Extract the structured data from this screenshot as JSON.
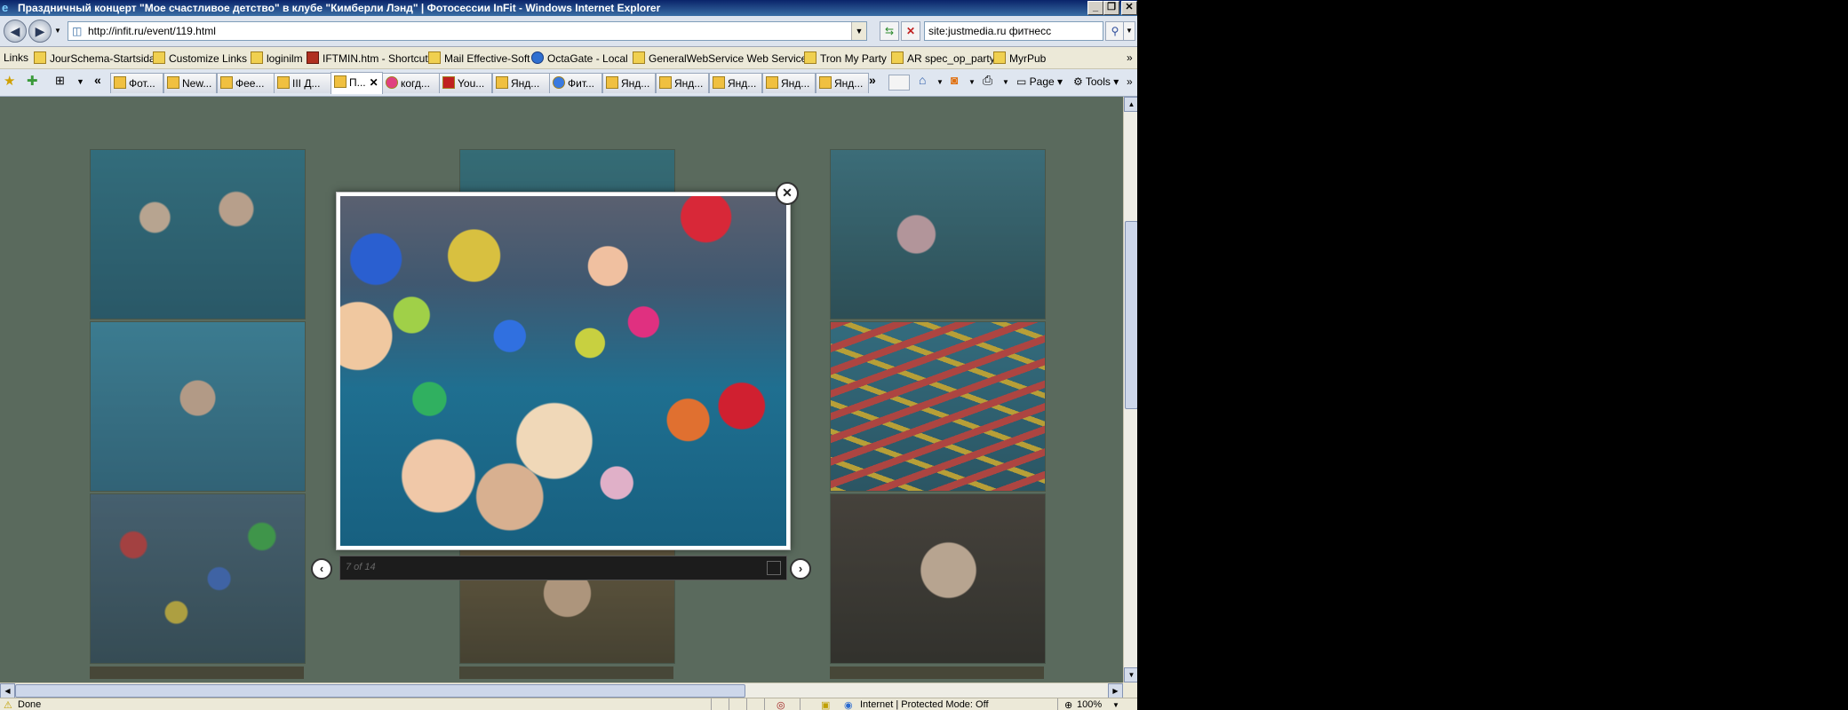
{
  "window": {
    "title": "Праздничный концерт \"Мое счастливое детство\" в клубе \"Кимберли Лэнд\" | Фотосессии InFit - Windows Internet Explorer",
    "controls": [
      "_",
      "❐",
      "✕"
    ]
  },
  "address": {
    "url": "http://infit.ru/event/119.html",
    "search_value": "site:justmedia.ru фитнесс"
  },
  "links_bar": {
    "label": "Links",
    "items": [
      "JourSchema-Startsida",
      "Customize Links",
      "loginilm",
      "IFTMIN.htm - Shortcut",
      "Mail Effective-Soft",
      "OctaGate - Local",
      "GeneralWebService Web Service",
      "Tron My Party",
      "AR spec_op_party",
      "MyrPub"
    ]
  },
  "tabs": {
    "items": [
      "Фот...",
      "New...",
      "Фее...",
      "III Д...",
      "П...",
      "когд...",
      "You...",
      "Янд...",
      "Фит...",
      "Янд...",
      "Янд...",
      "Янд...",
      "Янд...",
      "Янд..."
    ],
    "active_index": 4,
    "tools": {
      "page": "Page",
      "tools": "Tools"
    }
  },
  "lightbox": {
    "counter": "7 of 14"
  },
  "status": {
    "text": "Done",
    "zone": "Internet | Protected Mode: Off",
    "zoom": "100%"
  }
}
